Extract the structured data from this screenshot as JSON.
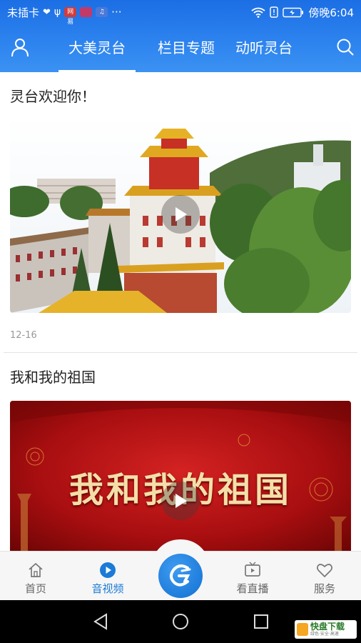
{
  "status_bar": {
    "carrier": "未插卡",
    "badges": [
      "网易",
      "",
      "♫"
    ],
    "time": "傍晚6:04"
  },
  "header": {
    "tabs": [
      {
        "label": "大美灵台",
        "active": true
      },
      {
        "label": "栏目专题",
        "active": false
      },
      {
        "label": "动听灵台",
        "active": false
      }
    ]
  },
  "feed": [
    {
      "title": "灵台欢迎你！",
      "date": "12-16"
    },
    {
      "title": "我和我的祖国",
      "overlay_text": "我和我的祖国"
    }
  ],
  "tab_bar": {
    "items": [
      {
        "label": "首页",
        "icon": "home-icon",
        "active": false
      },
      {
        "label": "音视频",
        "icon": "play-circle-icon",
        "active": true
      },
      {
        "label": "看直播",
        "icon": "tv-icon",
        "active": false
      },
      {
        "label": "服务",
        "icon": "heart-icon",
        "active": false
      }
    ]
  },
  "watermark": {
    "brand": "快盘下载",
    "sub": "绿色·安全·高速"
  },
  "colors": {
    "accent": "#1b7bd6",
    "header": "#2a80ec",
    "video_red": "#b01010"
  }
}
